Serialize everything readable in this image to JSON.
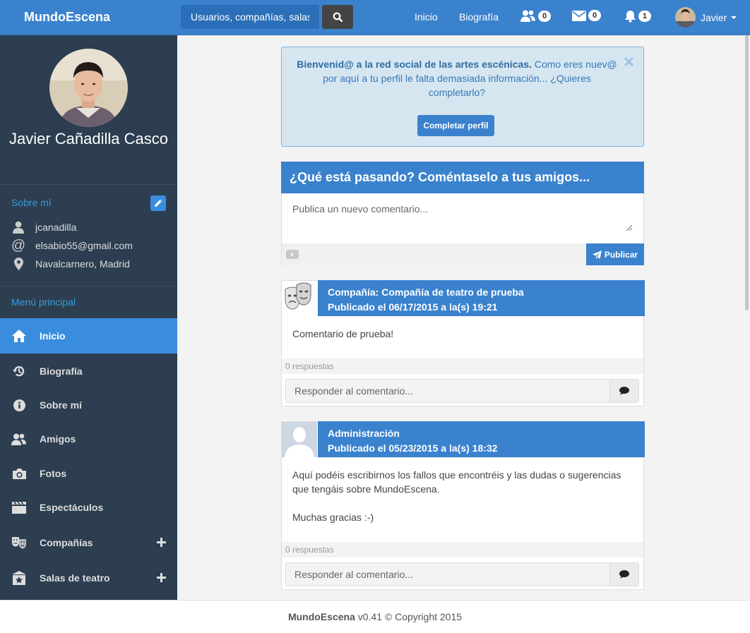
{
  "nav": {
    "brand": "MundoEscena",
    "search_placeholder": "Usuarios, compañías, salas...",
    "links": [
      "Inicio",
      "Biografía"
    ],
    "friends_count": "0",
    "messages_count": "0",
    "notifications_count": "1",
    "user_name": "Javier"
  },
  "profile": {
    "name": "Javier Cañadilla Casco",
    "about_title": "Sobre mí",
    "username": "jcanadilla",
    "email": "elsabio55@gmail.com",
    "location": "Navalcarnero, Madrid"
  },
  "menu": {
    "title": "Menú principal",
    "items": [
      {
        "label": "Inicio",
        "icon": "home-icon"
      },
      {
        "label": "Biografía",
        "icon": "history-icon"
      },
      {
        "label": "Sobre mí",
        "icon": "info-icon"
      },
      {
        "label": "Amigos",
        "icon": "friends-icon"
      },
      {
        "label": "Fotos",
        "icon": "camera-icon"
      },
      {
        "label": "Espectáculos",
        "icon": "clapperboard-icon"
      },
      {
        "label": "Compañías",
        "icon": "theater-masks-icon"
      },
      {
        "label": "Salas de teatro",
        "icon": "theater-building-icon"
      }
    ]
  },
  "welcome": {
    "bold": "Bienvenid@ a la red social de las artes escénicas.",
    "text": " Como eres nuev@ por aquí a tu perfil le falta demasiada información... ¿Quieres completarlo?",
    "button": "Completar perfil"
  },
  "composer": {
    "title": "¿Qué está pasando? Coméntaselo a tus amigos...",
    "placeholder": "Publica un nuevo comentario...",
    "publish": "Publicar"
  },
  "posts": [
    {
      "author": "Compañía: Compañía de teatro de prueba",
      "date": "Publicado el 06/17/2015 a la(s) 19:21",
      "body": [
        "Comentario de prueba!"
      ],
      "replies": "0 respuestas",
      "reply_placeholder": "Responder al comentario..."
    },
    {
      "author": "Administración",
      "date": "Publicado el 05/23/2015 a la(s) 18:32",
      "body": [
        "Aquí podéis escribirnos los fallos que encontréis y las dudas o sugerencias que tengáis sobre MundoEscena.",
        "Muchas gracias :-)"
      ],
      "replies": "0 respuestas",
      "reply_placeholder": "Responder al comentario..."
    }
  ],
  "footer": {
    "brand": "MundoEscena",
    "text": " v0.41 © Copyright 2015"
  },
  "colors": {
    "primary": "#3a82cd",
    "sidebar": "#2c3e50",
    "active": "#3a8dde"
  }
}
